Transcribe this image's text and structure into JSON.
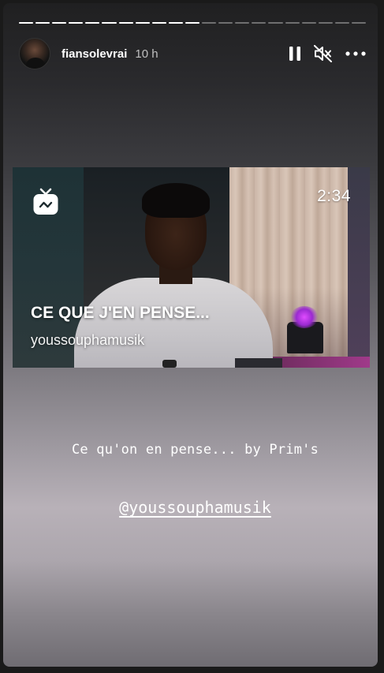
{
  "progress": {
    "segment_count": 21,
    "completed_segments": 11,
    "current_segment_fill": 0.0
  },
  "header": {
    "username": "fiansolevrai",
    "timestamp": "10 h",
    "pause_icon": "pause-icon",
    "mute_icon": "muted-speaker-icon",
    "more_icon": "more-horizontal-icon"
  },
  "video": {
    "app_icon": "igtv-icon",
    "duration": "2:34",
    "title": "CE QUE J'EN PENSE...",
    "channel": "youssouphamusik"
  },
  "caption": "Ce qu'on en pense... by Prim's",
  "mention": "@youssouphamusik",
  "colors": {
    "story_background_top": "#202021",
    "story_background_mid": "#b8b1b8",
    "text": "#ffffff",
    "progress_active": "#ffffff",
    "progress_inactive": "rgba(255,255,255,0.35)"
  }
}
